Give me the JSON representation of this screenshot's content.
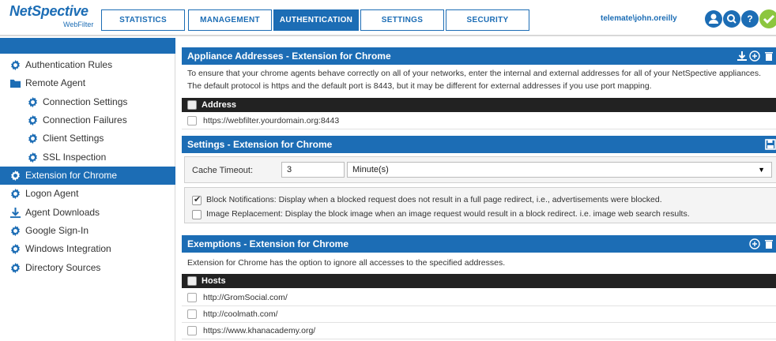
{
  "brand": {
    "name": "NetSpective",
    "sub": "WebFilter"
  },
  "nav": {
    "tabs": [
      {
        "label": "STATISTICS",
        "active": false
      },
      {
        "label": "MANAGEMENT",
        "active": false
      },
      {
        "label": "AUTHENTICATION",
        "active": true
      },
      {
        "label": "SETTINGS",
        "active": false
      },
      {
        "label": "SECURITY",
        "active": false
      }
    ],
    "user": "telemate\\john.oreilly"
  },
  "colors": {
    "accent": "#1c6db5",
    "dark_row": "#222222",
    "success": "#8cc63f"
  },
  "sidebar": {
    "items": [
      {
        "label": "Authentication Rules",
        "icon": "gear-icon"
      },
      {
        "label": "Remote Agent",
        "icon": "folder-icon"
      },
      {
        "label": "Connection Settings",
        "icon": "gear-icon"
      },
      {
        "label": "Connection Failures",
        "icon": "gear-icon"
      },
      {
        "label": "Client Settings",
        "icon": "gear-icon"
      },
      {
        "label": "SSL Inspection",
        "icon": "gear-icon"
      },
      {
        "label": "Extension for Chrome",
        "icon": "gear-icon",
        "active": true
      },
      {
        "label": "Logon Agent",
        "icon": "gear-icon"
      },
      {
        "label": "Agent Downloads",
        "icon": "download-icon"
      },
      {
        "label": "Google Sign-In",
        "icon": "gear-icon"
      },
      {
        "label": "Windows Integration",
        "icon": "gear-icon"
      },
      {
        "label": "Directory Sources",
        "icon": "gear-icon"
      }
    ]
  },
  "appliance": {
    "title": "Appliance Addresses - Extension for Chrome",
    "desc1": "To ensure that your chrome agents behave correctly on all of your networks, enter the internal and external addresses for all of your NetSpective appliances.",
    "desc2": "The default protocol is https and the default port is 8443, but it may be different for external addresses if you use port mapping.",
    "column": "Address",
    "rows": [
      "https://webfilter.yourdomain.org:8443"
    ]
  },
  "settings": {
    "title": "Settings - Extension for Chrome",
    "cache_label": "Cache Timeout:",
    "cache_value": "3",
    "cache_unit": "Minute(s)",
    "block_notifications": {
      "label": "Block Notifications: Display when a blocked request does not result in a full page redirect, i.e., advertisements were blocked.",
      "checked": true
    },
    "image_replacement": {
      "label": "Image Replacement: Display the block image when an image request would result in a block redirect. i.e. image web search results.",
      "checked": false
    }
  },
  "exemptions": {
    "title": "Exemptions - Extension for Chrome",
    "desc": "Extension for Chrome has the option to ignore all accesses to the specified addresses.",
    "column": "Hosts",
    "rows": [
      "http://GromSocial.com/",
      "http://coolmath.com/",
      "https://www.khanacademy.org/"
    ]
  }
}
